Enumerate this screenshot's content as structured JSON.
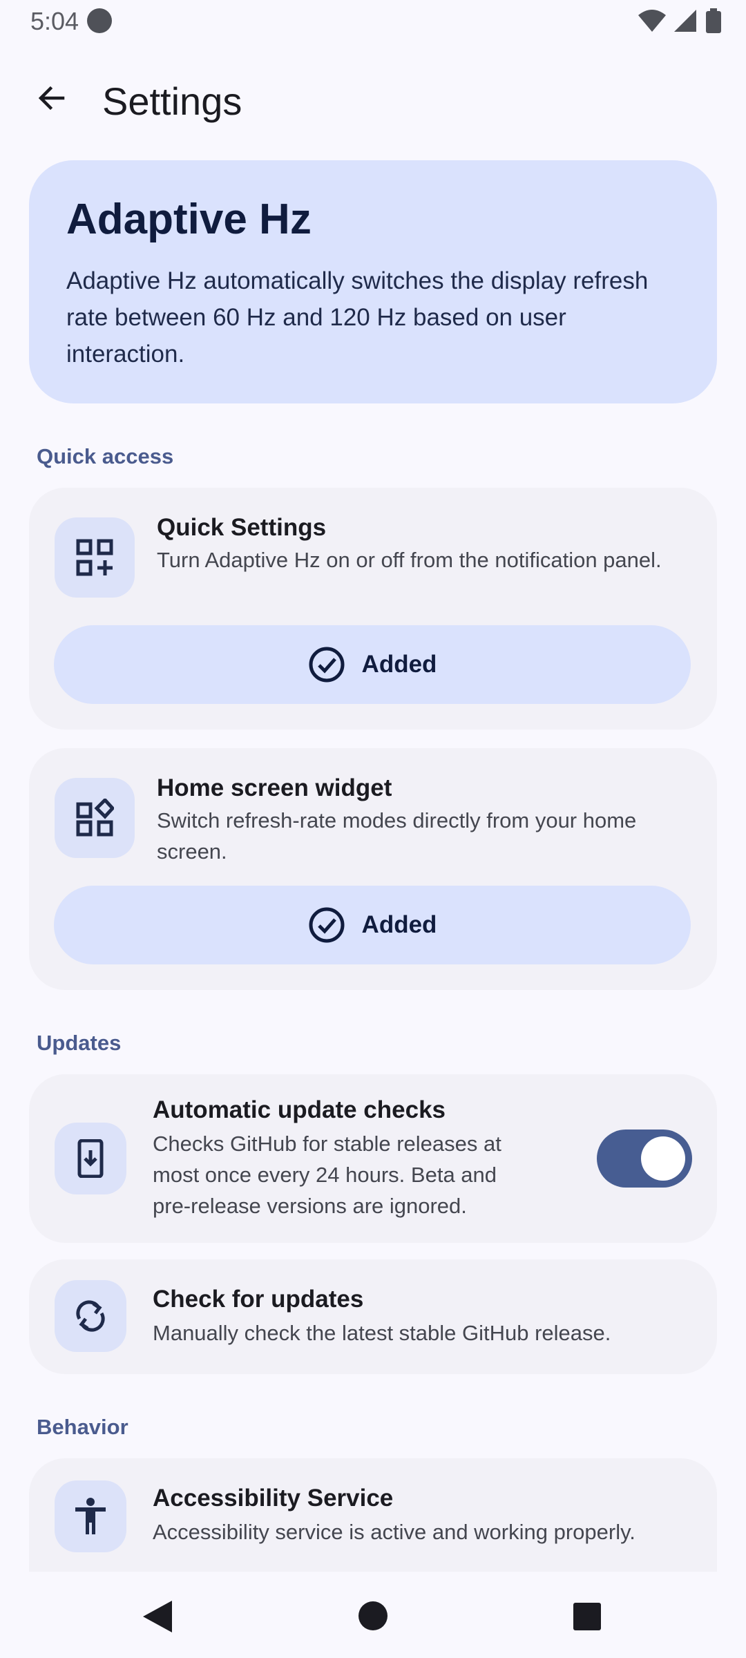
{
  "status_bar": {
    "time": "5:04"
  },
  "app_bar": {
    "title": "Settings",
    "back_icon": "arrow-back-icon"
  },
  "hero": {
    "title": "Adaptive Hz",
    "description": "Adaptive Hz automatically switches the display refresh rate between 60 Hz and 120 Hz based on user interaction."
  },
  "sections": {
    "quick_access": "Quick access",
    "updates": "Updates",
    "behavior": "Behavior"
  },
  "quick_settings": {
    "title": "Quick Settings",
    "description": "Turn Adaptive Hz on or off from the notification panel.",
    "button": "Added",
    "icon": "grid-add-icon"
  },
  "widget": {
    "title": "Home screen widget",
    "description": "Switch refresh-rate modes directly from your home screen.",
    "button": "Added",
    "icon": "widgets-icon"
  },
  "auto_updates": {
    "title": "Automatic update checks",
    "description": "Checks GitHub for stable releases at most once every 24 hours. Beta and pre-release versions are ignored.",
    "enabled": true,
    "icon": "phone-download-icon"
  },
  "check_updates": {
    "title": "Check for updates",
    "description": "Manually check the latest stable GitHub release.",
    "icon": "sync-icon"
  },
  "accessibility": {
    "title": "Accessibility Service",
    "description": "Accessibility service is active and working properly.",
    "icon": "accessibility-icon"
  },
  "colors": {
    "background": "#f9f8fe",
    "hero": "#dae2fd",
    "card": "#f2f1f7",
    "accent": "#475d92",
    "section_label": "#4a5b8e"
  }
}
